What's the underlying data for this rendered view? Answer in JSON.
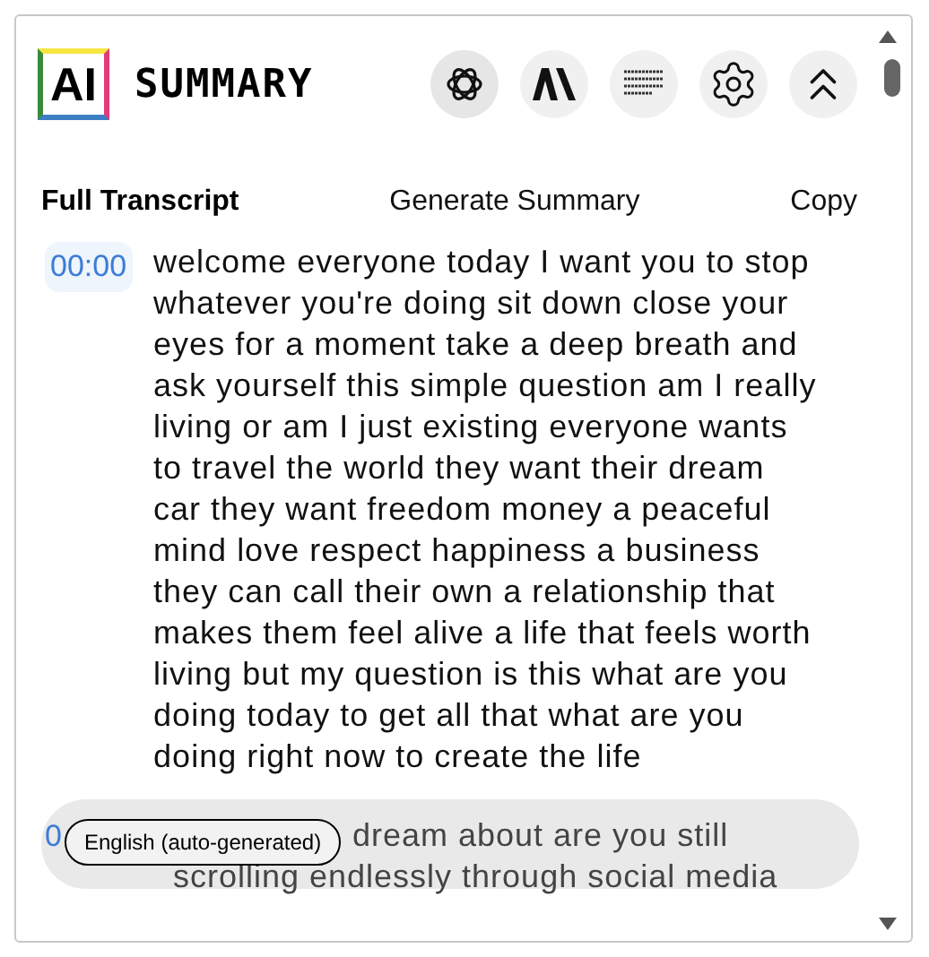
{
  "header": {
    "logo": "AI",
    "title": "SUMMARY"
  },
  "tabs": [
    {
      "label": "Full Transcript",
      "selected": true
    },
    {
      "label": "Generate Summary",
      "selected": false
    },
    {
      "label": "Copy",
      "selected": false
    }
  ],
  "segments": [
    {
      "time": "00:00",
      "text": "welcome everyone today I want you to stop whatever you're doing sit down close your eyes for a moment take a deep breath and ask yourself this simple question am I really living or am I just existing everyone wants to travel the world they want their dream car they want freedom money a peaceful mind love respect happiness a business they can call their own a relationship that makes them feel alive a life that feels worth living but my question is this what are you doing today to get all that what are you doing right now to create the life"
    },
    {
      "time": "0",
      "lines": [
        "dream about are you still",
        "scrolling endlessly through social media"
      ]
    }
  ],
  "caption_language": "English (auto-generated)"
}
